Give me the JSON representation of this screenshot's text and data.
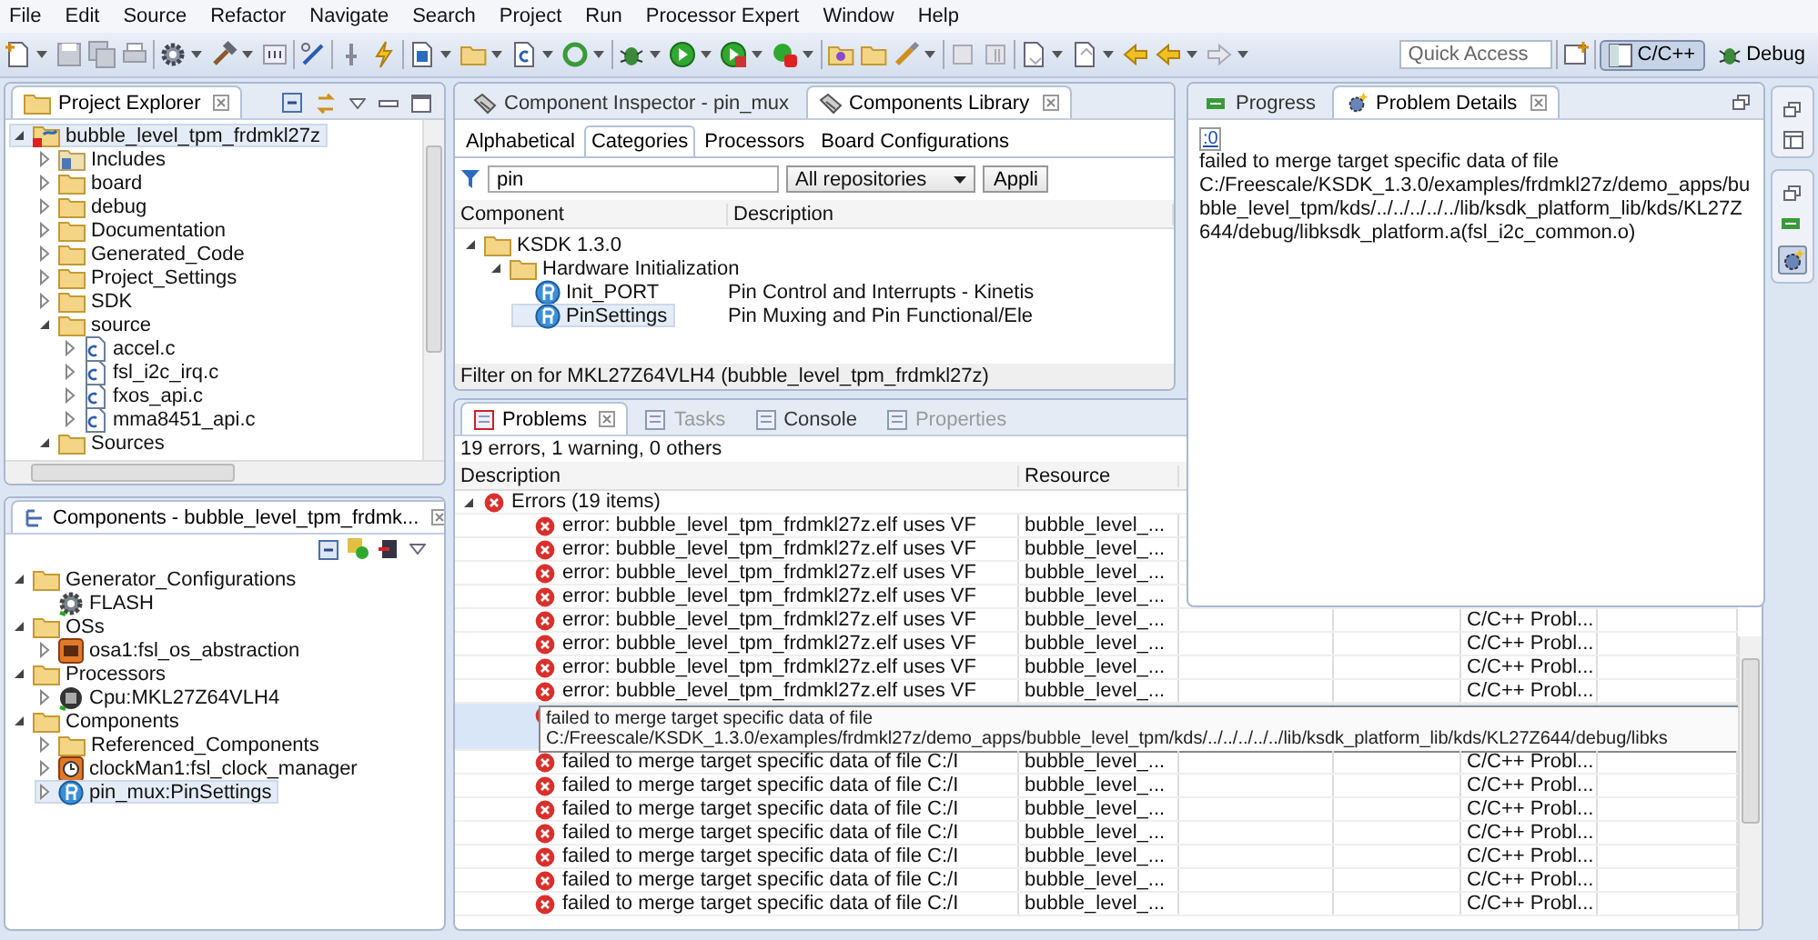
{
  "menu": [
    "File",
    "Edit",
    "Source",
    "Refactor",
    "Navigate",
    "Search",
    "Project",
    "Run",
    "Processor Expert",
    "Window",
    "Help"
  ],
  "toolbar": {
    "quick_access": {
      "placeholder": "Quick Access"
    },
    "perspectives": [
      {
        "label": "C/C++",
        "selected": true
      },
      {
        "label": "Debug",
        "selected": false
      }
    ]
  },
  "project_explorer": {
    "title": "Project Explorer",
    "items": [
      {
        "label": "bubble_level_tpm_frdmkl27z",
        "kind": "project",
        "expanded": true,
        "selected": true,
        "children": [
          {
            "label": "Includes",
            "kind": "includes",
            "expanded": false,
            "selected": false
          },
          {
            "label": "board",
            "kind": "folder",
            "expanded": false,
            "selected": false
          },
          {
            "label": "debug",
            "kind": "folder",
            "expanded": false,
            "selected": false
          },
          {
            "label": "Documentation",
            "kind": "folder",
            "expanded": false,
            "selected": false
          },
          {
            "label": "Generated_Code",
            "kind": "folder",
            "expanded": false,
            "selected": false
          },
          {
            "label": "Project_Settings",
            "kind": "folder",
            "expanded": false,
            "selected": false
          },
          {
            "label": "SDK",
            "kind": "folder",
            "expanded": false,
            "selected": false
          },
          {
            "label": "source",
            "kind": "folder",
            "expanded": true,
            "selected": false,
            "children": [
              {
                "label": "accel.c",
                "kind": "file",
                "expanded": false,
                "selected": false
              },
              {
                "label": "fsl_i2c_irq.c",
                "kind": "file",
                "expanded": false,
                "selected": false
              },
              {
                "label": "fxos_api.c",
                "kind": "file",
                "expanded": false,
                "selected": false
              },
              {
                "label": "mma8451_api.c",
                "kind": "file",
                "expanded": false,
                "selected": false
              }
            ]
          },
          {
            "label": "Sources",
            "kind": "folder",
            "expanded": true,
            "selected": false
          }
        ]
      }
    ]
  },
  "components_view": {
    "title": "Components - bubble_level_tpm_frdmk...",
    "items": [
      {
        "label": "Generator_Configurations",
        "kind": "folder",
        "expanded": true,
        "selected": false,
        "children": [
          {
            "label": "FLASH",
            "kind": "gear",
            "selected": false
          }
        ]
      },
      {
        "label": "OSs",
        "kind": "folder",
        "expanded": true,
        "selected": false,
        "children": [
          {
            "label": "osa1:fsl_os_abstraction",
            "kind": "os",
            "expanded": false,
            "selected": false
          }
        ]
      },
      {
        "label": "Processors",
        "kind": "folder",
        "expanded": true,
        "selected": false,
        "children": [
          {
            "label": "Cpu:MKL27Z64VLH4",
            "kind": "cpu",
            "expanded": false,
            "selected": false
          }
        ]
      },
      {
        "label": "Components",
        "kind": "folder",
        "expanded": true,
        "selected": false,
        "children": [
          {
            "label": "Referenced_Components",
            "kind": "folder",
            "expanded": false,
            "selected": false
          },
          {
            "label": "clockMan1:fsl_clock_manager",
            "kind": "clock",
            "expanded": false,
            "selected": false
          },
          {
            "label": "pin_mux:PinSettings",
            "kind": "pin",
            "expanded": false,
            "selected": true
          }
        ]
      }
    ]
  },
  "components_library": {
    "tabs": [
      {
        "label": "Component Inspector - pin_mux",
        "selected": false
      },
      {
        "label": "Components Library",
        "selected": true
      }
    ],
    "subtabs": [
      {
        "label": "Alphabetical",
        "selected": false
      },
      {
        "label": "Categories",
        "selected": true
      },
      {
        "label": "Processors",
        "selected": false
      },
      {
        "label": "Board Configurations",
        "selected": false
      }
    ],
    "filter": {
      "value": "pin"
    },
    "repository": "All repositories",
    "apply_button": "Appli",
    "columns": [
      "Component",
      "Description"
    ],
    "items": [
      {
        "label": "KSDK 1.3.0",
        "kind": "folder",
        "expanded": true,
        "selected": false,
        "children": [
          {
            "label": "Hardware Initialization",
            "kind": "folder",
            "expanded": true,
            "selected": false,
            "children": [
              {
                "label": "Init_PORT",
                "kind": "pin",
                "selected": false,
                "description": "Pin Control and Interrupts - Kinetis"
              },
              {
                "label": "PinSettings",
                "kind": "pin",
                "selected": true,
                "description": "Pin Muxing and Pin Functional/Ele"
              }
            ]
          }
        ]
      }
    ],
    "status": "Filter on for MKL27Z64VLH4 (bubble_level_tpm_frdmkl27z)"
  },
  "problems": {
    "tabs": [
      {
        "label": "Problems",
        "selected": true,
        "disabled": false
      },
      {
        "label": "Tasks",
        "selected": false,
        "disabled": true
      },
      {
        "label": "Console",
        "selected": false,
        "disabled": false
      },
      {
        "label": "Properties",
        "selected": false,
        "disabled": true
      }
    ],
    "summary": "19 errors, 1 warning, 0 others",
    "columns": [
      "Description",
      "Resource"
    ],
    "group": {
      "label": "Errors (19 items)",
      "expanded": true
    },
    "rows": [
      {
        "description": "error: bubble_level_tpm_frdmkl27z.elf uses VF",
        "resource": "bubble_level_...",
        "selected": false
      },
      {
        "description": "error: bubble_level_tpm_frdmkl27z.elf uses VF",
        "resource": "bubble_level_...",
        "selected": false
      },
      {
        "description": "error: bubble_level_tpm_frdmkl27z.elf uses VF",
        "resource": "bubble_level_...",
        "selected": false
      },
      {
        "description": "error: bubble_level_tpm_frdmkl27z.elf uses VF",
        "resource": "bubble_level_...",
        "selected": false
      },
      {
        "description": "error: bubble_level_tpm_frdmkl27z.elf uses VF",
        "resource": "bubble_level_...",
        "type": "C/C++ Probl...",
        "selected": false
      },
      {
        "description": "error: bubble_level_tpm_frdmkl27z.elf uses VF",
        "resource": "bubble_level_...",
        "type": "C/C++ Probl...",
        "selected": false
      },
      {
        "description": "error: bubble_level_tpm_frdmkl27z.elf uses VF",
        "resource": "bubble_level_...",
        "type": "C/C++ Probl...",
        "selected": false
      },
      {
        "description": "error: bubble_level_tpm_frdmkl27z.elf uses VF",
        "resource": "bubble_level_...",
        "type": "C/C++ Probl...",
        "selected": false
      },
      {
        "selected": true
      },
      {
        "description": "failed to merge target specific data of file C:/I",
        "resource": "bubble_level_...",
        "type": "C/C++ Probl...",
        "selected": false
      },
      {
        "description": "failed to merge target specific data of file C:/I",
        "resource": "bubble_level_...",
        "type": "C/C++ Probl...",
        "selected": false
      },
      {
        "description": "failed to merge target specific data of file C:/I",
        "resource": "bubble_level_...",
        "type": "C/C++ Probl...",
        "selected": false
      },
      {
        "description": "failed to merge target specific data of file C:/I",
        "resource": "bubble_level_...",
        "type": "C/C++ Probl...",
        "selected": false
      },
      {
        "description": "failed to merge target specific data of file C:/I",
        "resource": "bubble_level_...",
        "type": "C/C++ Probl...",
        "selected": false
      },
      {
        "description": "failed to merge target specific data of file C:/I",
        "resource": "bubble_level_...",
        "type": "C/C++ Probl...",
        "selected": false
      },
      {
        "description": "failed to merge target specific data of file C:/I",
        "resource": "bubble_level_...",
        "type": "C/C++ Probl...",
        "selected": false
      }
    ],
    "tooltip": "failed to merge target specific data of file C:/Freescale/KSDK_1.3.0/examples/frdmkl27z/demo_apps/bubble_level_tpm/kds/../../../../../lib/ksdk_platform_lib/kds/KL27Z644/debug/libks"
  },
  "problem_details": {
    "tabs": [
      {
        "label": "Progress",
        "selected": false
      },
      {
        "label": "Problem Details",
        "selected": true
      }
    ],
    "link": ":0",
    "message": "failed to merge target specific data of file C:/Freescale/KSDK_1.3.0/examples/frdmkl27z/demo_apps/bubble_level_tpm/kds/../../../../../lib/ksdk_platform_lib/kds/KL27Z644/debug/libksdk_platform.a(fsl_i2c_common.o)"
  }
}
